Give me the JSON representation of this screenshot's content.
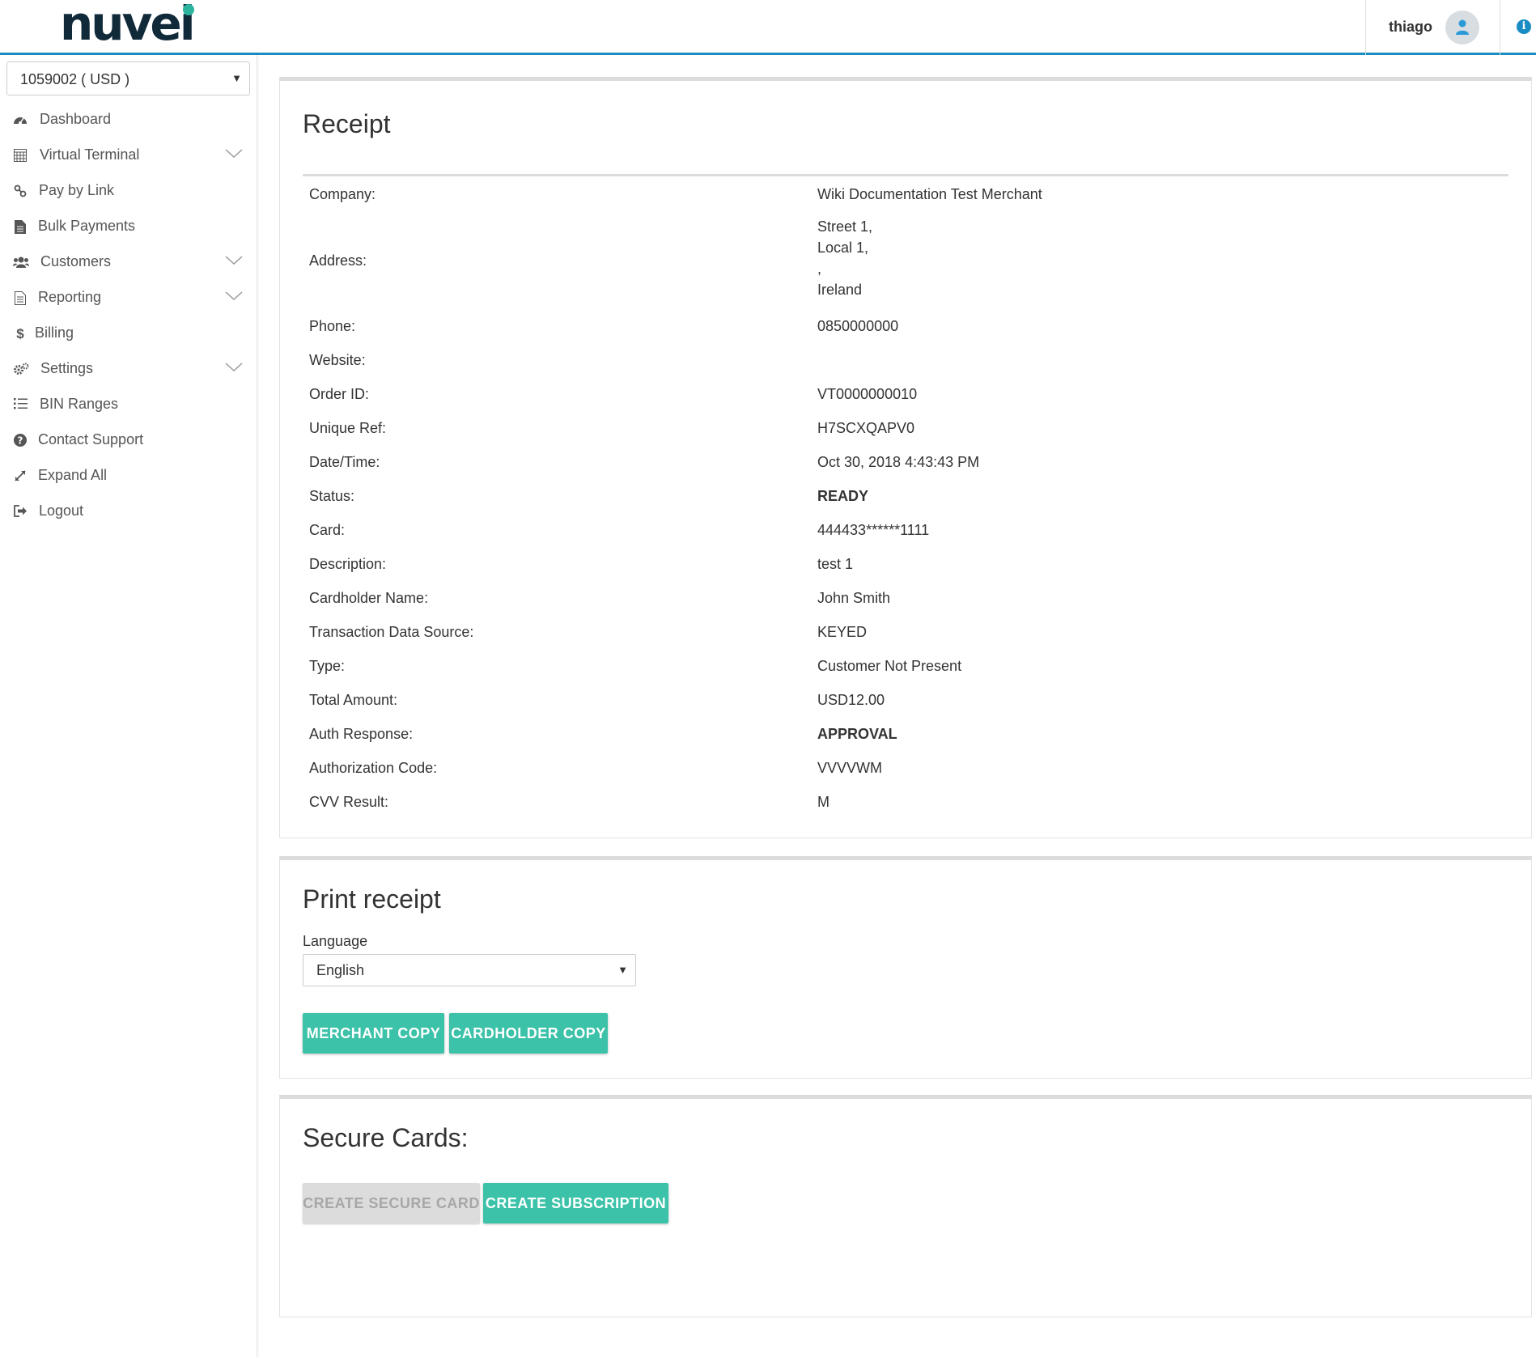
{
  "header": {
    "logo_text": "nuvei",
    "user_name": "thiago",
    "user_icon": "user-icon",
    "info_icon": "info-icon"
  },
  "sidebar": {
    "account": "1059002 ( USD )",
    "items": [
      {
        "label": "Dashboard",
        "icon": "dashboard-icon",
        "expandable": false
      },
      {
        "label": "Virtual Terminal",
        "icon": "calculator-icon",
        "expandable": true
      },
      {
        "label": "Pay by Link",
        "icon": "link-icon",
        "expandable": false
      },
      {
        "label": "Bulk Payments",
        "icon": "file-icon",
        "expandable": false
      },
      {
        "label": "Customers",
        "icon": "users-icon",
        "expandable": true
      },
      {
        "label": "Reporting",
        "icon": "report-icon",
        "expandable": true
      },
      {
        "label": "Billing",
        "icon": "dollar-icon",
        "expandable": false
      },
      {
        "label": "Settings",
        "icon": "gears-icon",
        "expandable": true
      },
      {
        "label": "BIN Ranges",
        "icon": "list-icon",
        "expandable": false
      },
      {
        "label": "Contact Support",
        "icon": "question-icon",
        "expandable": false
      },
      {
        "label": "Expand All",
        "icon": "expand-icon",
        "expandable": false
      },
      {
        "label": "Logout",
        "icon": "logout-icon",
        "expandable": false
      }
    ]
  },
  "receipt": {
    "title": "Receipt",
    "company_label": "Company:",
    "company": "Wiki Documentation Test Merchant",
    "address_label": "Address:",
    "address_lines": [
      "Street 1,",
      "Local 1,",
      ",",
      "Ireland"
    ],
    "rows": [
      {
        "label": "Phone:",
        "value": "0850000000",
        "bold": false
      },
      {
        "label": "Website:",
        "value": "",
        "bold": false
      },
      {
        "label": "Order ID:",
        "value": "VT0000000010",
        "bold": false
      },
      {
        "label": "Unique Ref:",
        "value": "H7SCXQAPV0",
        "bold": false
      },
      {
        "label": "Date/Time:",
        "value": "Oct 30, 2018 4:43:43 PM",
        "bold": false
      },
      {
        "label": "Status:",
        "value": "READY",
        "bold": true
      },
      {
        "label": "Card:",
        "value": "444433******1111",
        "bold": false
      },
      {
        "label": "Description:",
        "value": "test 1",
        "bold": false
      },
      {
        "label": "Cardholder Name:",
        "value": "John Smith",
        "bold": false
      },
      {
        "label": "Transaction Data Source:",
        "value": "KEYED",
        "bold": false
      },
      {
        "label": "Type:",
        "value": "Customer Not Present",
        "bold": false
      },
      {
        "label": "Total Amount:",
        "value": "USD12.00",
        "bold": false
      },
      {
        "label": "Auth Response:",
        "value": "APPROVAL",
        "bold": true
      },
      {
        "label": "Authorization Code:",
        "value": "VVVVWM",
        "bold": false
      },
      {
        "label": "CVV Result:",
        "value": "M",
        "bold": false
      }
    ]
  },
  "print_receipt": {
    "title": "Print receipt",
    "language_label": "Language",
    "language_value": "English",
    "merchant_copy": "MERCHANT COPY",
    "cardholder_copy": "CARDHOLDER COPY"
  },
  "secure_cards": {
    "title": "Secure Cards:",
    "create_secure_card": "CREATE SECURE CARD",
    "create_subscription": "CREATE SUBSCRIPTION"
  },
  "colors": {
    "accent": "#3cc2a8",
    "header_line": "#1a8cc4",
    "logo": "#112a3a"
  }
}
